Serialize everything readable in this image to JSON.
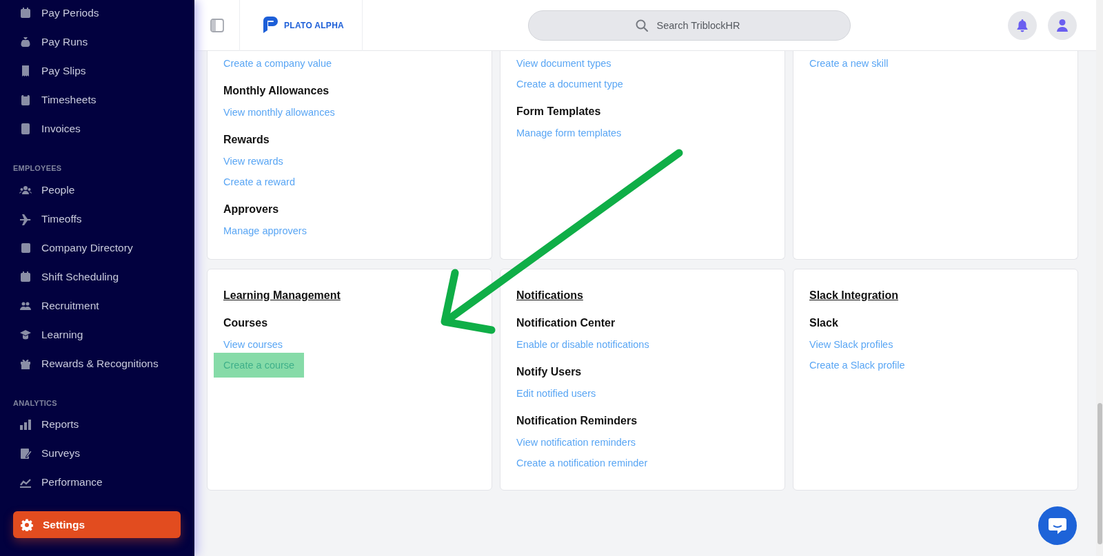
{
  "sidebar": {
    "sections": [
      {
        "items": [
          {
            "label": "Pay Periods",
            "selected": false
          },
          {
            "label": "Pay Runs",
            "selected": false
          },
          {
            "label": "Pay Slips",
            "selected": false
          },
          {
            "label": "Timesheets",
            "selected": false
          },
          {
            "label": "Invoices",
            "selected": false
          }
        ]
      },
      {
        "label": "EMPLOYEES",
        "items": [
          {
            "label": "People",
            "selected": false
          },
          {
            "label": "Timeoffs",
            "selected": false
          },
          {
            "label": "Company Directory",
            "selected": false
          },
          {
            "label": "Shift Scheduling",
            "selected": false
          },
          {
            "label": "Recruitment",
            "selected": false
          },
          {
            "label": "Learning",
            "selected": false
          },
          {
            "label": "Rewards & Recognitions",
            "selected": false
          }
        ]
      },
      {
        "label": "ANALYTICS",
        "items": [
          {
            "label": "Reports",
            "selected": false
          },
          {
            "label": "Surveys",
            "selected": false
          },
          {
            "label": "Performance",
            "selected": false
          }
        ]
      }
    ],
    "footer_item": {
      "label": "Settings",
      "selected": true
    }
  },
  "header": {
    "logo_text": "PLATO ALPHA",
    "search": {
      "placeholder": "Search TriblockHR"
    }
  },
  "card_rows": [
    {
      "cards": [
        {
          "sections": [
            {
              "links": [
                {
                  "label": "Create a company value",
                  "highlighted": false
                }
              ]
            },
            {
              "heading": "Monthly Allowances",
              "links": [
                {
                  "label": "View monthly allowances",
                  "highlighted": false
                }
              ]
            },
            {
              "heading": "Rewards",
              "links": [
                {
                  "label": "View rewards",
                  "highlighted": false
                },
                {
                  "label": "Create a reward",
                  "highlighted": false
                }
              ]
            },
            {
              "heading": "Approvers",
              "links": [
                {
                  "label": "Manage approvers",
                  "highlighted": false
                }
              ]
            }
          ]
        },
        {
          "sections": [
            {
              "links": [
                {
                  "label": "View document types",
                  "highlighted": false
                },
                {
                  "label": "Create a document type",
                  "highlighted": false
                }
              ]
            },
            {
              "heading": "Form Templates",
              "links": [
                {
                  "label": "Manage form templates",
                  "highlighted": false
                }
              ]
            }
          ]
        },
        {
          "sections": [
            {
              "links": [
                {
                  "label": "Create a new skill",
                  "highlighted": false
                }
              ]
            }
          ]
        }
      ]
    },
    {
      "cards": [
        {
          "title": "Learning Management",
          "sections": [
            {
              "heading": "Courses",
              "links": [
                {
                  "label": "View courses",
                  "highlighted": false
                },
                {
                  "label": "Create a course",
                  "highlighted": true
                }
              ]
            }
          ]
        },
        {
          "title": "Notifications",
          "sections": [
            {
              "heading": "Notification Center",
              "links": [
                {
                  "label": "Enable or disable notifications",
                  "highlighted": false
                }
              ]
            },
            {
              "heading": "Notify Users",
              "links": [
                {
                  "label": "Edit notified users",
                  "highlighted": false
                }
              ]
            },
            {
              "heading": "Notification Reminders",
              "links": [
                {
                  "label": "View notification reminders",
                  "highlighted": false
                },
                {
                  "label": "Create a notification reminder",
                  "highlighted": false
                }
              ]
            }
          ]
        },
        {
          "title": "Slack Integration",
          "sections": [
            {
              "heading": "Slack",
              "links": [
                {
                  "label": "View Slack profiles",
                  "highlighted": false
                },
                {
                  "label": "Create a Slack profile",
                  "highlighted": false
                }
              ]
            }
          ]
        }
      ]
    }
  ]
}
